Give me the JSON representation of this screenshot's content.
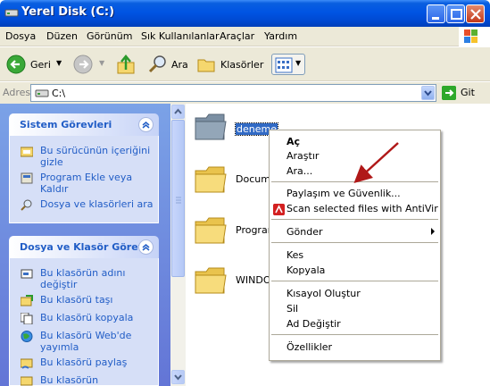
{
  "window": {
    "title": "Yerel Disk (C:)"
  },
  "menubar": [
    "Dosya",
    "Düzen",
    "Görünüm",
    "Sık Kullanılanlar",
    "Araçlar",
    "Yardım"
  ],
  "toolbar": {
    "back": "Geri",
    "search": "Ara",
    "folders": "Klasörler"
  },
  "address": {
    "label": "Adres",
    "value": "C:\\",
    "go": "Git"
  },
  "taskpane": {
    "system": {
      "title": "Sistem Görevleri",
      "items": [
        "Bu sürücünün içeriğini gizle",
        "Program Ekle veya Kaldır",
        "Dosya ve klasörleri ara"
      ]
    },
    "filefolder": {
      "title": "Dosya ve Klasör Görevl",
      "items": [
        "Bu klasörün adını değiştir",
        "Bu klasörü taşı",
        "Bu klasörü kopyala",
        "Bu klasörü Web'de yayımla",
        "Bu klasörü paylaş",
        "Bu klasörün dosyalarını"
      ]
    }
  },
  "files": [
    "deneme",
    "Docume",
    "Program",
    "WINDO"
  ],
  "context_menu": {
    "open": "Aç",
    "explore": "Araştır",
    "search": "Ara...",
    "sharing": "Paylaşım ve Güvenlik...",
    "antivir": "Scan selected files with AntiVir",
    "sendto": "Gönder",
    "cut": "Kes",
    "copy": "Kopyala",
    "shortcut": "Kısayol Oluştur",
    "delete": "Sil",
    "rename": "Ad Değiştir",
    "properties": "Özellikler"
  },
  "colors": {
    "title_bar": "#0054e3",
    "taskpane_bg": "#6f8fdf",
    "task_link": "#215dc6",
    "selection": "#316ac5",
    "annotation_arrow": "#b01818"
  }
}
